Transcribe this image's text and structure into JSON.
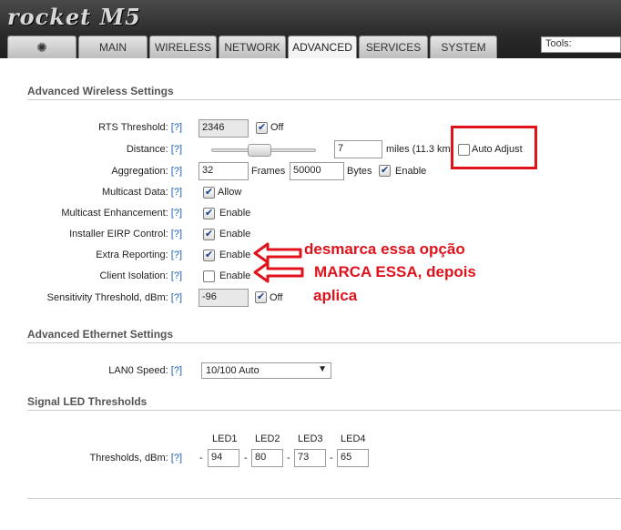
{
  "brand": "rocket M5",
  "tabs": [
    {
      "label": "MAIN"
    },
    {
      "label": "WIRELESS"
    },
    {
      "label": "NETWORK"
    },
    {
      "label": "ADVANCED"
    },
    {
      "label": "SERVICES"
    },
    {
      "label": "SYSTEM"
    }
  ],
  "tools_label": "Tools:",
  "help": "[?]",
  "wireless": {
    "title": "Advanced Wireless Settings",
    "rts_label": "RTS Threshold:",
    "rts_value": "2346",
    "rts_off": "Off",
    "distance_label": "Distance:",
    "distance_value": "7",
    "distance_units": "miles (11.3 km)",
    "auto_adjust": "Auto Adjust",
    "aggregation_label": "Aggregation:",
    "agg_frames_value": "32",
    "agg_frames_unit": "Frames",
    "agg_bytes_value": "50000",
    "agg_bytes_unit": "Bytes",
    "agg_enable": "Enable",
    "multicast_label": "Multicast Data:",
    "multicast_allow": "Allow",
    "mc_enh_label": "Multicast Enhancement:",
    "installer_label": "Installer EIRP Control:",
    "extra_label": "Extra Reporting:",
    "client_label": "Client Isolation:",
    "enable": "Enable",
    "sens_label": "Sensitivity Threshold, dBm:",
    "sens_value": "-96",
    "sens_off": "Off"
  },
  "ethernet": {
    "title": "Advanced Ethernet Settings",
    "lan_label": "LAN0 Speed:",
    "lan_value": "10/100 Auto"
  },
  "led": {
    "title": "Signal LED Thresholds",
    "headers": [
      "LED1",
      "LED2",
      "LED3",
      "LED4"
    ],
    "label": "Thresholds, dBm:",
    "values": [
      "94",
      "80",
      "73",
      "65"
    ]
  },
  "annotations": {
    "line1": "desmarca essa opção",
    "line2": "MARCA ESSA, depois",
    "line3": "aplica",
    "color": "#e0121b"
  }
}
